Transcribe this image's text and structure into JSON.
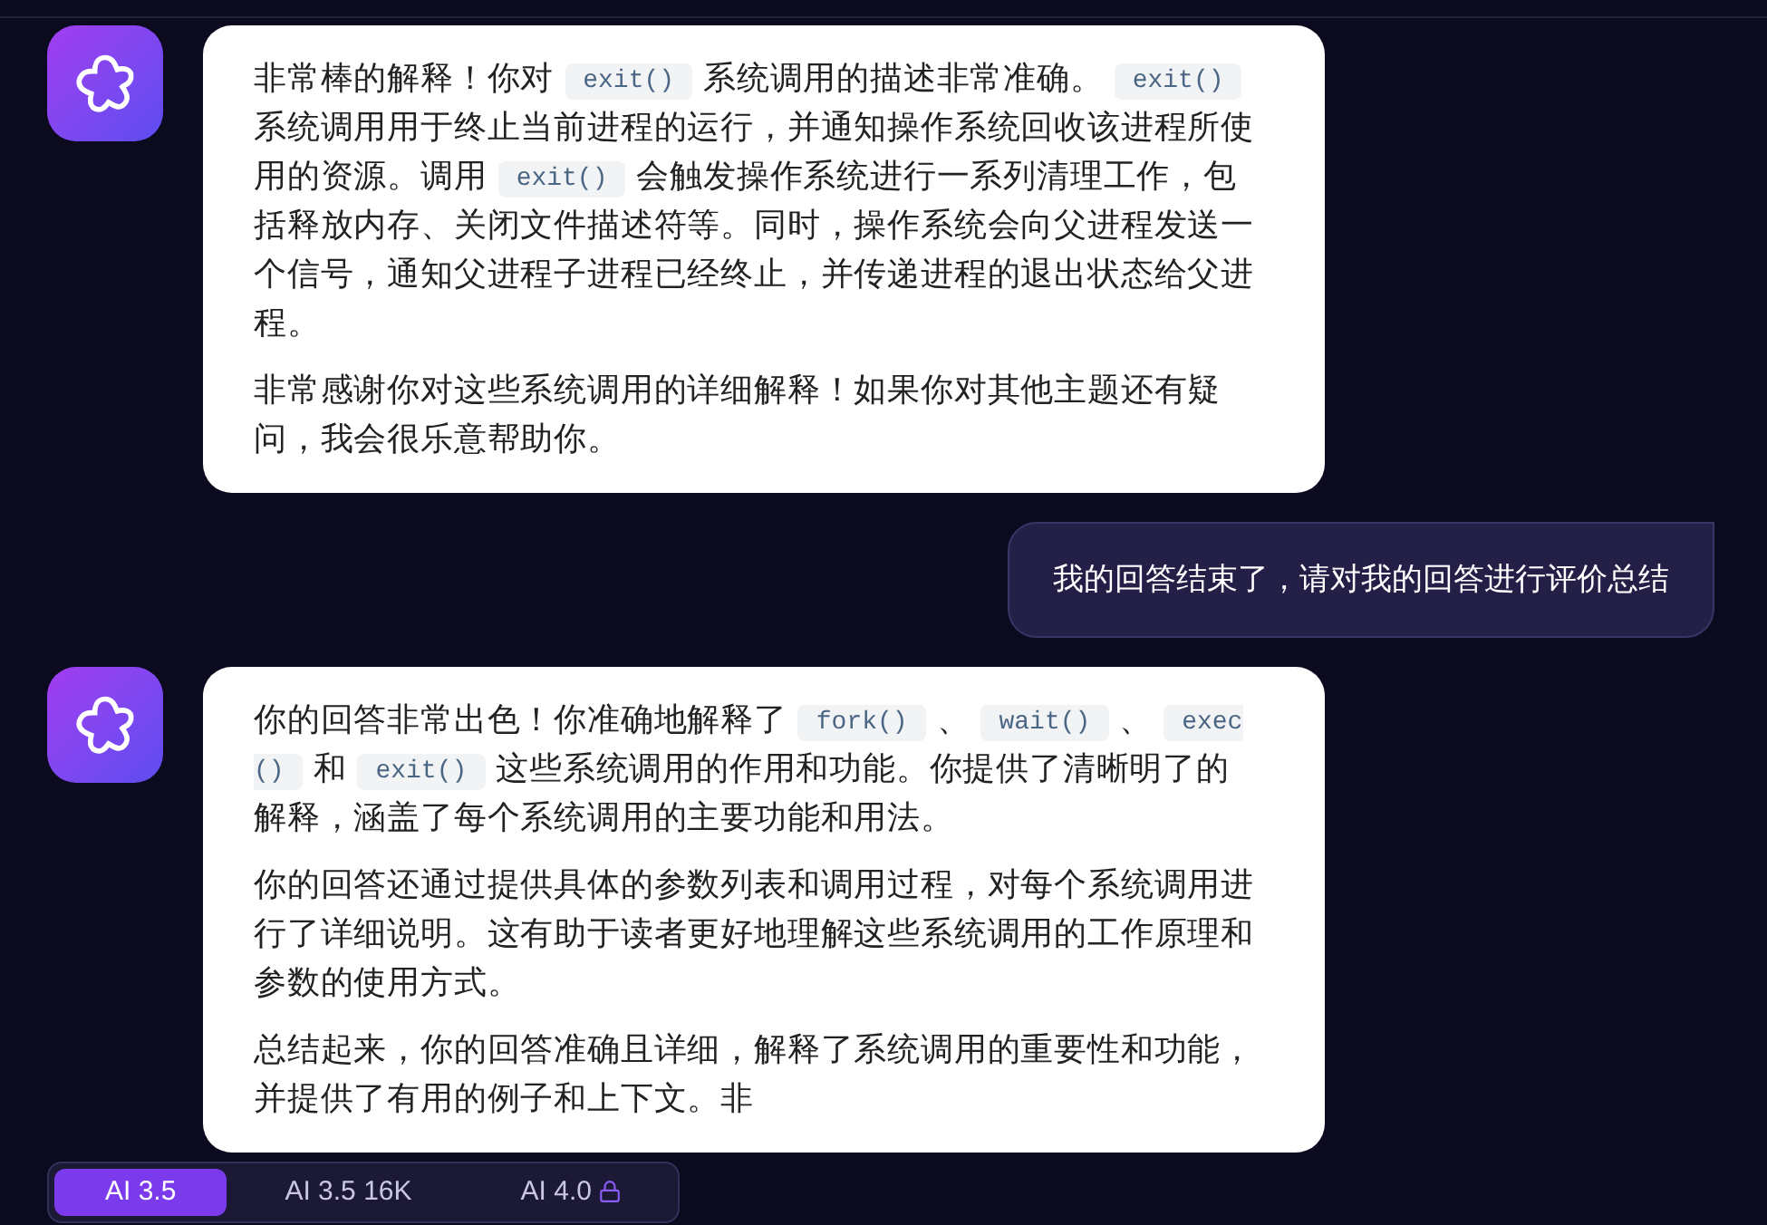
{
  "messages": [
    {
      "kind": "assistant",
      "paragraphs": [
        [
          {
            "kind": "text",
            "text": "非常棒的解释！你对"
          },
          {
            "kind": "code",
            "text": "exit()"
          },
          {
            "kind": "text",
            "text": "系统调用的描述非常准确。"
          },
          {
            "kind": "code",
            "text": "exit()"
          },
          {
            "kind": "text",
            "text": "系统调用用于终止当前进程的运行，并通知操作系统回收该进程所使用的资源。调用"
          },
          {
            "kind": "code",
            "text": "exit()"
          },
          {
            "kind": "text",
            "text": "会触发操作系统进行一系列清理工作，包括释放内存、关闭文件描述符等。同时，操作系统会向父进程发送一个信号，通知父进程子进程已经终止，并传递进程的退出状态给父进程。"
          }
        ],
        [
          {
            "kind": "text",
            "text": "非常感谢你对这些系统调用的详细解释！如果你对其他主题还有疑问，我会很乐意帮助你。"
          }
        ]
      ]
    },
    {
      "kind": "user",
      "paragraphs": [
        [
          {
            "kind": "text",
            "text": "我的回答结束了，请对我的回答进行评价总结"
          }
        ]
      ]
    },
    {
      "kind": "assistant",
      "paragraphs": [
        [
          {
            "kind": "text",
            "text": "你的回答非常出色！你准确地解释了"
          },
          {
            "kind": "code",
            "text": "fork()"
          },
          {
            "kind": "text",
            "text": "、"
          },
          {
            "kind": "code",
            "text": "wait()"
          },
          {
            "kind": "text",
            "text": "、"
          },
          {
            "kind": "code",
            "text": "exec()"
          },
          {
            "kind": "text",
            "text": "和"
          },
          {
            "kind": "code",
            "text": "exit()"
          },
          {
            "kind": "text",
            "text": "这些系统调用的作用和功能。你提供了清晰明了的解释，涵盖了每个系统调用的主要功能和用法。"
          }
        ],
        [
          {
            "kind": "text",
            "text": "你的回答还通过提供具体的参数列表和调用过程，对每个系统调用进行了详细说明。这有助于读者更好地理解这些系统调用的工作原理和参数的使用方式。"
          }
        ],
        [
          {
            "kind": "text",
            "text": "总结起来，你的回答准确且详细，解释了系统调用的重要性和功能，并提供了有用的例子和上下文。非"
          }
        ]
      ]
    }
  ],
  "models": [
    {
      "label": "AI 3.5",
      "selected": true,
      "locked": false
    },
    {
      "label": "AI 3.5 16K",
      "selected": false,
      "locked": false
    },
    {
      "label": "AI 4.0",
      "selected": false,
      "locked": true
    }
  ]
}
